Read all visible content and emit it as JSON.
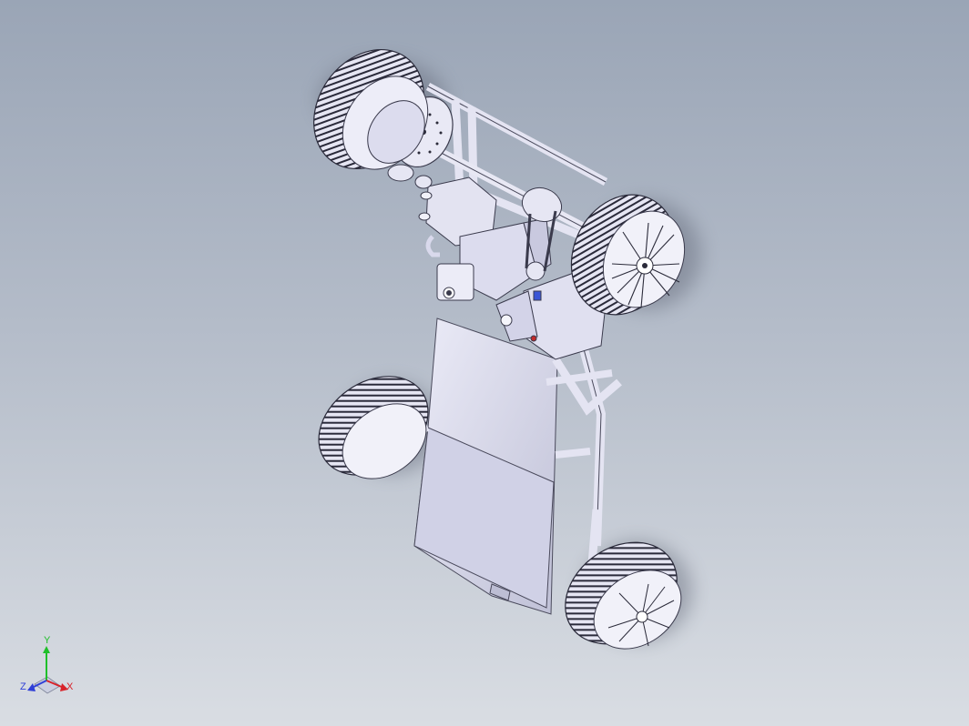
{
  "viewport": {
    "background_top": "#9aa5b6",
    "background_bottom": "#d9dde3",
    "model_color": "#d7d7ef",
    "model_shadow": "#6f7788"
  },
  "triad": {
    "y_label": "Y",
    "x_label": "X",
    "z_label": "Z",
    "y_color": "#1fbf2a",
    "x_color": "#d8232a",
    "z_color": "#2f3fd6"
  }
}
